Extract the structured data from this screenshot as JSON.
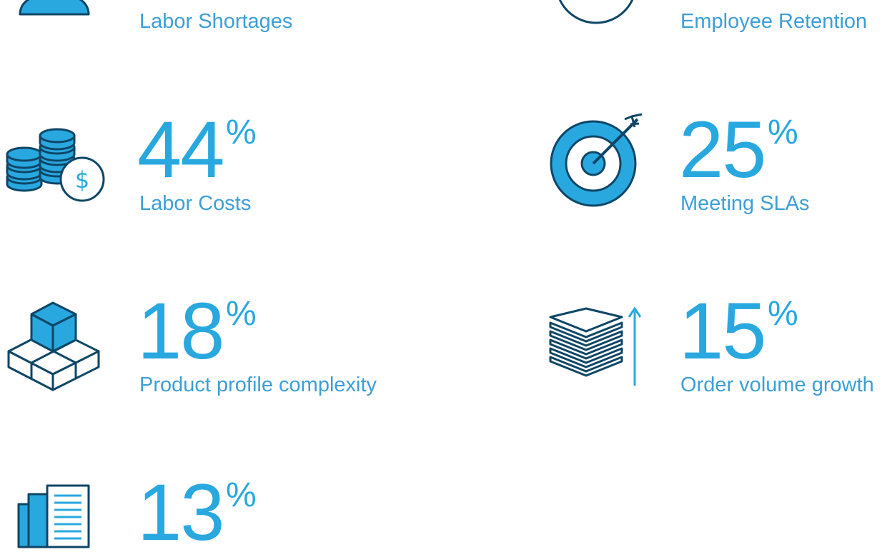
{
  "colors": {
    "accent": "#29a8e0",
    "icon_dark": "#0e4666",
    "label": "#3c9fd6"
  },
  "stats": [
    {
      "label": "Labor Shortages",
      "icon": "person-icon"
    },
    {
      "label": "Employee Retention",
      "icon": "circle-icon"
    },
    {
      "value": "44",
      "percent": "%",
      "label": "Labor Costs",
      "icon": "coins-dollar-icon"
    },
    {
      "value": "25",
      "percent": "%",
      "label": "Meeting SLAs",
      "icon": "target-arrow-icon"
    },
    {
      "value": "18",
      "percent": "%",
      "label": "Product profile complexity",
      "icon": "boxes-icon"
    },
    {
      "value": "15",
      "percent": "%",
      "label": "Order volume growth",
      "icon": "stacked-layers-arrow-icon"
    },
    {
      "value": "13",
      "percent": "%",
      "icon": "documents-icon"
    }
  ]
}
